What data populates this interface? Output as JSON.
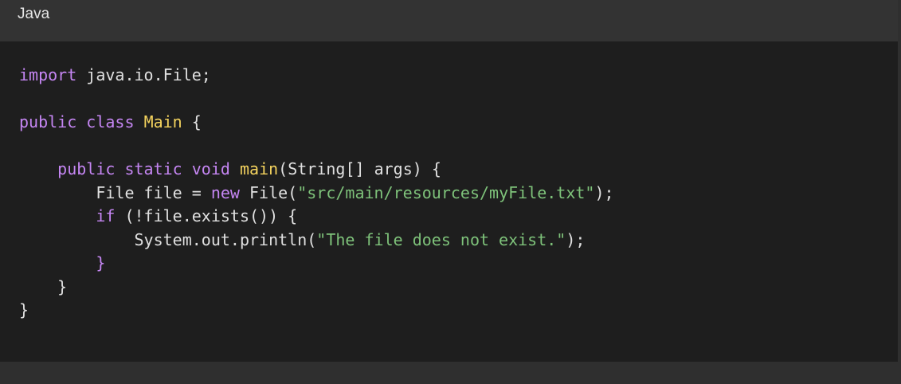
{
  "header": {
    "language": "Java"
  },
  "colors": {
    "keyword": "#c586f3",
    "class_name": "#f4d35e",
    "string": "#7ec27a",
    "text": "#e0e0e0",
    "header_bg": "#333333",
    "code_bg": "#1e1e1e"
  },
  "code": {
    "l1": {
      "kw": "import",
      "rest": " java.io.File;"
    },
    "l3": {
      "kw1": "public",
      "kw2": "class",
      "cls": "Main",
      "rest": " {"
    },
    "l5": {
      "indent": "    ",
      "kw1": "public",
      "kw2": "static",
      "kw3": "void",
      "fn": "main",
      "rest": "(String[] args) {"
    },
    "l6": {
      "indent": "        ",
      "pre": "File file = ",
      "kw": "new",
      "mid": " File(",
      "str": "\"src/main/resources/myFile.txt\"",
      "post": ");"
    },
    "l7": {
      "indent": "        ",
      "kw": "if",
      "rest": " (!file.exists()) {"
    },
    "l8": {
      "indent": "            ",
      "pre": "System.out.println(",
      "str": "\"The file does not exist.\"",
      "post": ");"
    },
    "l9": {
      "indent": "        ",
      "rest": "}"
    },
    "l10": {
      "indent": "    ",
      "rest": "}"
    },
    "l11": {
      "rest": "}"
    }
  }
}
